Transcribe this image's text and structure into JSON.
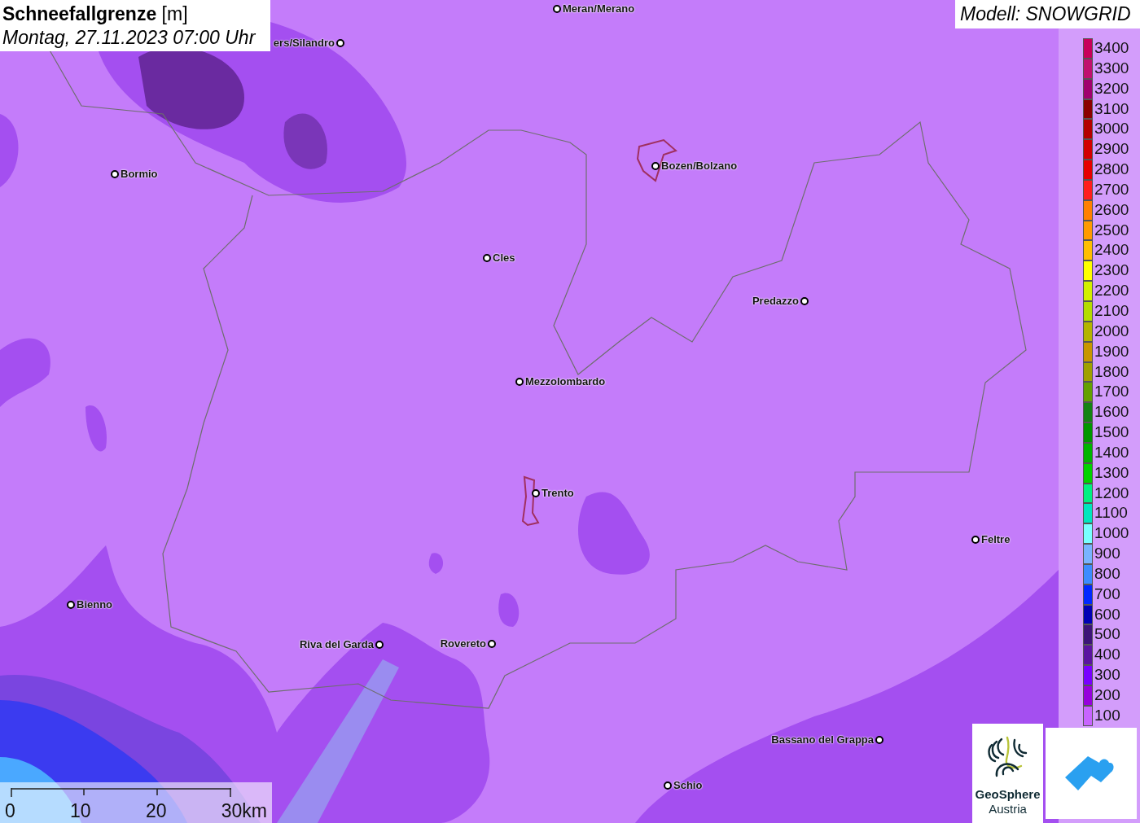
{
  "title": "**Schneefallgrenze** [m]",
  "subtitle": "Montag, 27.11.2023 07:00 Uhr",
  "model": "Modell: SNOWGRID",
  "cities": [
    {
      "name": "ers/Silandro"
    },
    {
      "name": "Meran/Merano"
    },
    {
      "name": "Bormio"
    },
    {
      "name": "Bozen/Bolzano"
    },
    {
      "name": "Cles"
    },
    {
      "name": "Predazzo"
    },
    {
      "name": "Mezzolombardo"
    },
    {
      "name": "Trento"
    },
    {
      "name": "Feltre"
    },
    {
      "name": "Bienno"
    },
    {
      "name": "Riva del Garda"
    },
    {
      "name": "Rovereto"
    },
    {
      "name": "Bassano del Grappa"
    },
    {
      "name": "Schio"
    }
  ],
  "legend": [
    {
      "label": "3400",
      "color": "#c8005a"
    },
    {
      "label": "3300",
      "color": "#c0106e"
    },
    {
      "label": "3200",
      "color": "#a0006e"
    },
    {
      "label": "3100",
      "color": "#8b0000"
    },
    {
      "label": "3000",
      "color": "#b40000"
    },
    {
      "label": "2900",
      "color": "#d20000"
    },
    {
      "label": "2800",
      "color": "#e60000"
    },
    {
      "label": "2700",
      "color": "#ff1e1e"
    },
    {
      "label": "2600",
      "color": "#ff8000"
    },
    {
      "label": "2500",
      "color": "#ff9a00"
    },
    {
      "label": "2400",
      "color": "#ffbe00"
    },
    {
      "label": "2300",
      "color": "#ffff00"
    },
    {
      "label": "2200",
      "color": "#d2f000"
    },
    {
      "label": "2100",
      "color": "#b4dc00"
    },
    {
      "label": "2000",
      "color": "#b4b400"
    },
    {
      "label": "1900",
      "color": "#c89600"
    },
    {
      "label": "1800",
      "color": "#a0a000"
    },
    {
      "label": "1700",
      "color": "#64a000"
    },
    {
      "label": "1600",
      "color": "#148214"
    },
    {
      "label": "1500",
      "color": "#009600"
    },
    {
      "label": "1400",
      "color": "#00b400"
    },
    {
      "label": "1300",
      "color": "#00d200"
    },
    {
      "label": "1200",
      "color": "#00f082"
    },
    {
      "label": "1100",
      "color": "#00e6be"
    },
    {
      "label": "1000",
      "color": "#78ffff"
    },
    {
      "label": "900",
      "color": "#78b4ff"
    },
    {
      "label": "800",
      "color": "#3c8cff"
    },
    {
      "label": "700",
      "color": "#0028ff"
    },
    {
      "label": "600",
      "color": "#0000b4"
    },
    {
      "label": "500",
      "color": "#3c1478"
    },
    {
      "label": "400",
      "color": "#5a14a0"
    },
    {
      "label": "300",
      "color": "#7800ff"
    },
    {
      "label": "200",
      "color": "#9600dc"
    },
    {
      "label": "100",
      "color": "#c864ff"
    }
  ],
  "scale": [
    "0",
    "10",
    "20",
    "30km"
  ],
  "logo": {
    "line1": "GeoSphere",
    "line2": "Austria"
  }
}
